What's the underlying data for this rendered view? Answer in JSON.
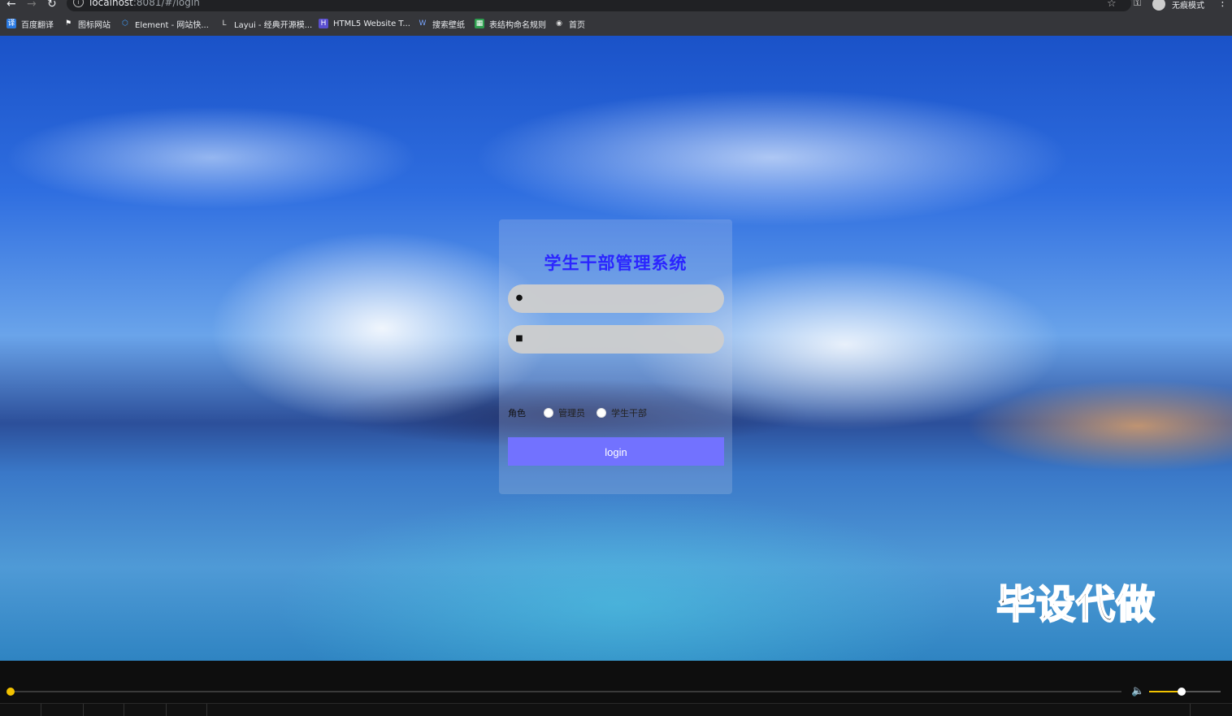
{
  "browser": {
    "url_host": "localhost",
    "url_rest": ":8081/#/login",
    "incognito_label": "无痕模式"
  },
  "bookmarks": [
    {
      "label": "百度翻译",
      "icon": "baidu-translate-icon",
      "color": "#2a7ae2"
    },
    {
      "label": "图标网站",
      "icon": "flag-icon",
      "color": "#333333"
    },
    {
      "label": "Element - 网站快...",
      "icon": "element-icon",
      "color": "#409eff"
    },
    {
      "label": "Layui - 经典开源模...",
      "icon": "layui-icon",
      "color": "#555555"
    },
    {
      "label": "HTML5 Website T...",
      "icon": "html5-template-icon",
      "color": "#5a4fcf"
    },
    {
      "label": "搜索壁纸",
      "icon": "wallpaper-icon",
      "color": "#3b6fd6"
    },
    {
      "label": "表结构命名规则",
      "icon": "table-icon",
      "color": "#2e9e4f"
    },
    {
      "label": "首页",
      "icon": "globe-icon",
      "color": "#777777"
    }
  ],
  "login": {
    "title": "学生干部管理系统",
    "username_placeholder": "",
    "password_placeholder": "",
    "role_label": "角色",
    "roles": [
      "管理员",
      "学生干部"
    ],
    "button_label": "login"
  },
  "watermark": "毕设代做",
  "player": {
    "progress": 0.0,
    "volume": 0.45
  }
}
